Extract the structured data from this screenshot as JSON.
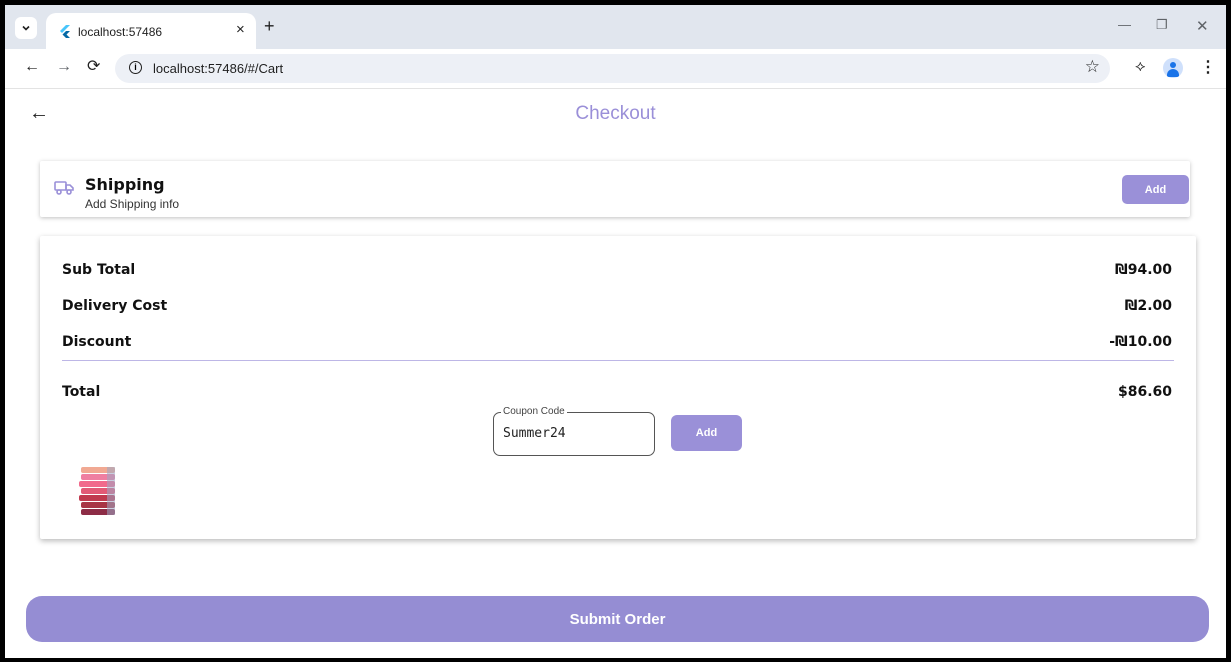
{
  "browser": {
    "tab_title": "localhost:57486",
    "tab_close": "×",
    "new_tab": "+",
    "url": "localhost:57486/#/Cart",
    "icons": [
      "tab-search-icon",
      "flutter-favicon-icon",
      "back-icon",
      "forward-icon",
      "reload-icon",
      "site-info-icon",
      "bookmark-star-icon",
      "extensions-icon",
      "profile-icon",
      "menu-icon",
      "minimize-icon",
      "restore-icon",
      "close-icon"
    ]
  },
  "page": {
    "title": "Checkout",
    "accent_color": "#958dd3"
  },
  "shipping": {
    "title": "Shipping",
    "subtitle": "Add Shipping info",
    "add_label": "Add",
    "icon": "truck-icon"
  },
  "summary": {
    "rows": [
      {
        "label": "Sub Total",
        "value": "₪94.00"
      },
      {
        "label": "Delivery Cost",
        "value": "₪2.00"
      },
      {
        "label": "Discount",
        "value": "-₪10.00"
      }
    ],
    "total_label": "Total",
    "total_value": "$86.60"
  },
  "coupon": {
    "label": "Coupon Code",
    "value": "Summer24",
    "add_label": "Add"
  },
  "submit_label": "Submit Order"
}
